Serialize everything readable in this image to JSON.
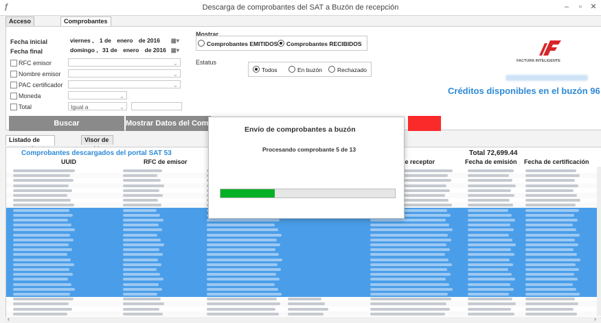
{
  "window": {
    "title": "Descarga de comprobantes del SAT a Buzón de recepción",
    "controls": [
      "–",
      "▫",
      "✕"
    ]
  },
  "tabs": [
    "Acceso portal SAT",
    "Comprobantes descargados"
  ],
  "filters": {
    "fecha_inicial_label": "Fecha inicial",
    "fecha_final_label": "Fecha final",
    "fecha_inicial": {
      "dow": "viernes",
      "day": "1 de",
      "month": "enero",
      "year": "de 2016"
    },
    "fecha_final": {
      "dow": "domingo",
      "day": "31 de",
      "month": "enero",
      "year": "de 2016"
    },
    "rfc_emisor": "RFC emisor",
    "nombre_emisor": "Nombre emisor",
    "pac_certificador": "PAC certificador",
    "moneda": "Moneda",
    "total": "Total",
    "total_operator": "Igual a"
  },
  "mostrar": {
    "label": "Mostrar",
    "options": [
      "Comprobantes EMITIDOS",
      "Comprobantes RECIBIDOS"
    ],
    "selected": 1
  },
  "estatus": {
    "label": "Estatus",
    "options": [
      "Todos",
      "En buzón",
      "Rechazado"
    ],
    "selected": 0
  },
  "brand": {
    "logo_text": "FACTURA INTELIGENTE",
    "accent": "#d7262a"
  },
  "credits": "Créditos disponibles en el buzón 96",
  "buttons": {
    "buscar": "Buscar",
    "mostrar_datos": "Mostrar Datos del Comproba"
  },
  "lower_tabs": [
    "Listado de comprobantes",
    "Visor de archivos XML"
  ],
  "grid": {
    "summary": "Comprobantes descargados del portal SAT 53",
    "total": "Total 72,699.44",
    "columns": {
      "uuid": "UUID",
      "rfc_emisor": "RFC de emisor",
      "receptor": "le receptor",
      "fecha_emision": "Fecha de emisión",
      "fecha_certificacion": "Fecha de certificación"
    }
  },
  "dialog": {
    "title": "Envío de comprobantes a buzón",
    "status": "Procesando comprobante 5 de 13",
    "progress": 0.31
  },
  "colors": {
    "selection": "#4a9ee9",
    "credits": "#2e8ad6",
    "progress": "#06b025"
  }
}
